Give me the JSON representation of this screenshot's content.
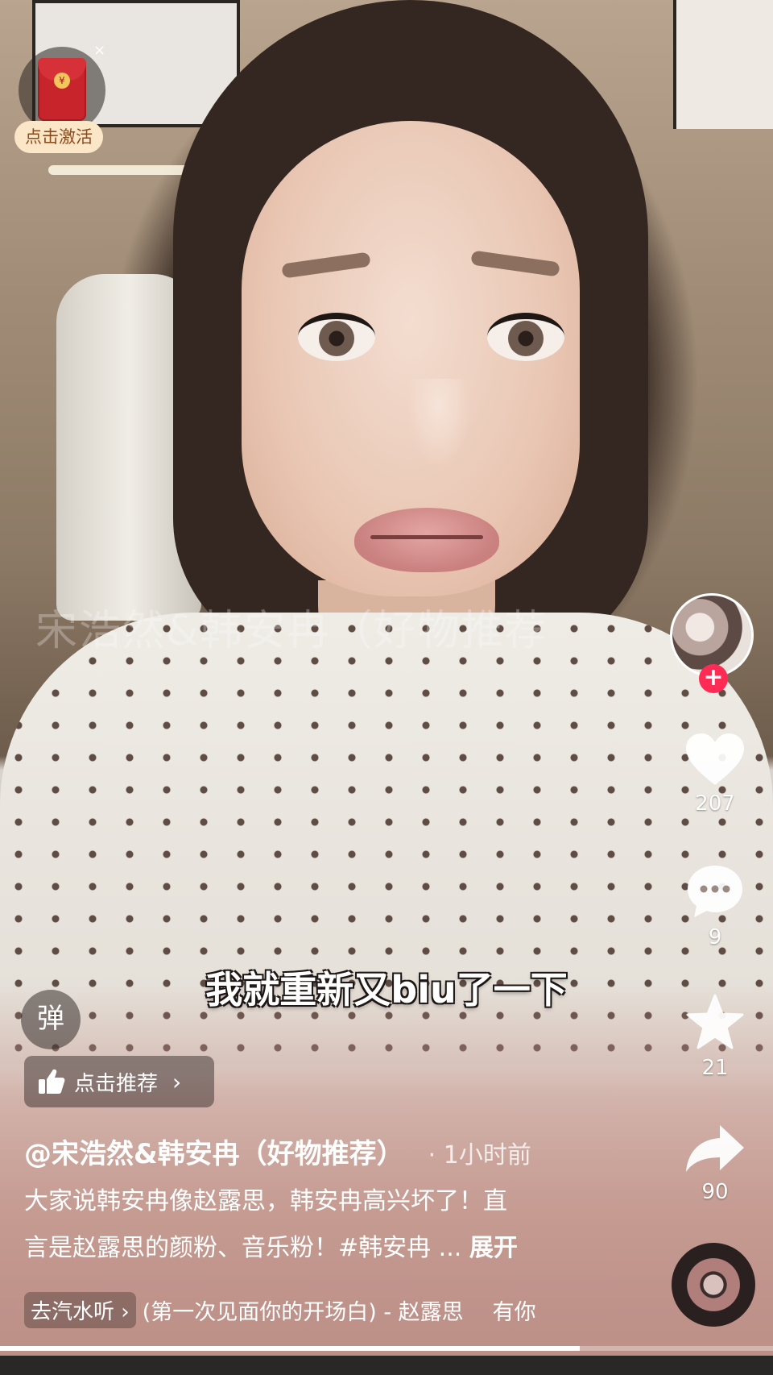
{
  "redpack": {
    "label": "点击激活",
    "close_glyph": "×"
  },
  "watermark": "宋浩然&韩安冉（好物推荐",
  "subtitle": "我就重新又biu了一下",
  "danmaku": {
    "label": "弹"
  },
  "recommend": {
    "label": "点击推荐",
    "chevron": "›"
  },
  "author": {
    "name": "@宋浩然&韩安冉（好物推荐）",
    "time": "· 1小时前"
  },
  "description": {
    "line1": "大家说韩安冉像赵露思，韩安冉高兴坏了！直",
    "line2": "言是赵露思的颜粉、音乐粉！#韩安冉 ... ",
    "expand": "展开"
  },
  "music": {
    "tag": "去汽水听 ›",
    "text": "(第一次见面你的开场白) - 赵露思",
    "text2": "有你"
  },
  "rail": {
    "follow_glyph": "+",
    "likes": "207",
    "comments": "9",
    "favorites": "21",
    "shares": "90"
  },
  "progress": {
    "fraction": 0.75
  },
  "colors": {
    "follow": "#fe2c55",
    "icon": "#ffffff"
  }
}
